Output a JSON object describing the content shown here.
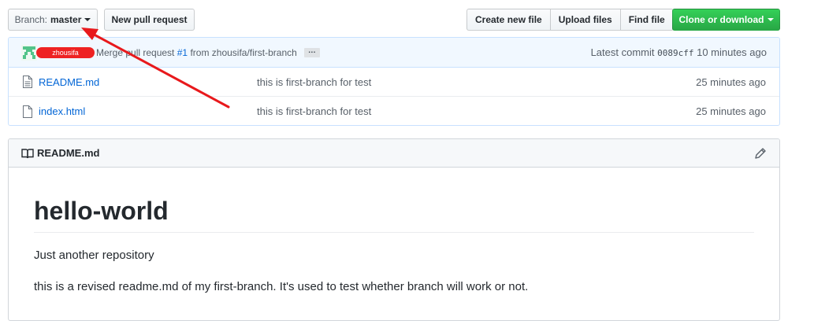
{
  "toolbar": {
    "branch_prefix": "Branch:",
    "branch_name": "master",
    "new_pull_request": "New pull request",
    "create_new_file": "Create new file",
    "upload_files": "Upload files",
    "find_file": "Find file",
    "clone_or_download": "Clone or download"
  },
  "commit": {
    "author_redacted": "zhousifa",
    "message_prefix": "Merge pull request",
    "pr_number": "#1",
    "message_suffix": "from zhousifa/first-branch",
    "ellipsis": "…",
    "latest_label": "Latest commit",
    "sha": "0089cff",
    "age": "10 minutes ago"
  },
  "files": [
    {
      "name": "README.md",
      "message": "this is first-branch for test",
      "age": "25 minutes ago"
    },
    {
      "name": "index.html",
      "message": "this is first-branch for test",
      "age": "25 minutes ago"
    }
  ],
  "readme": {
    "header": "README.md",
    "title": "hello-world",
    "paragraph1": "Just another repository",
    "paragraph2": "this is a revised readme.md of my first-branch. It's used to test whether branch will work or not."
  },
  "colors": {
    "link": "#0366d6",
    "green_button": "#28a745",
    "commit_bg": "#f1f8ff",
    "annotation_arrow": "#e8191c",
    "redaction": "#ee2222"
  }
}
